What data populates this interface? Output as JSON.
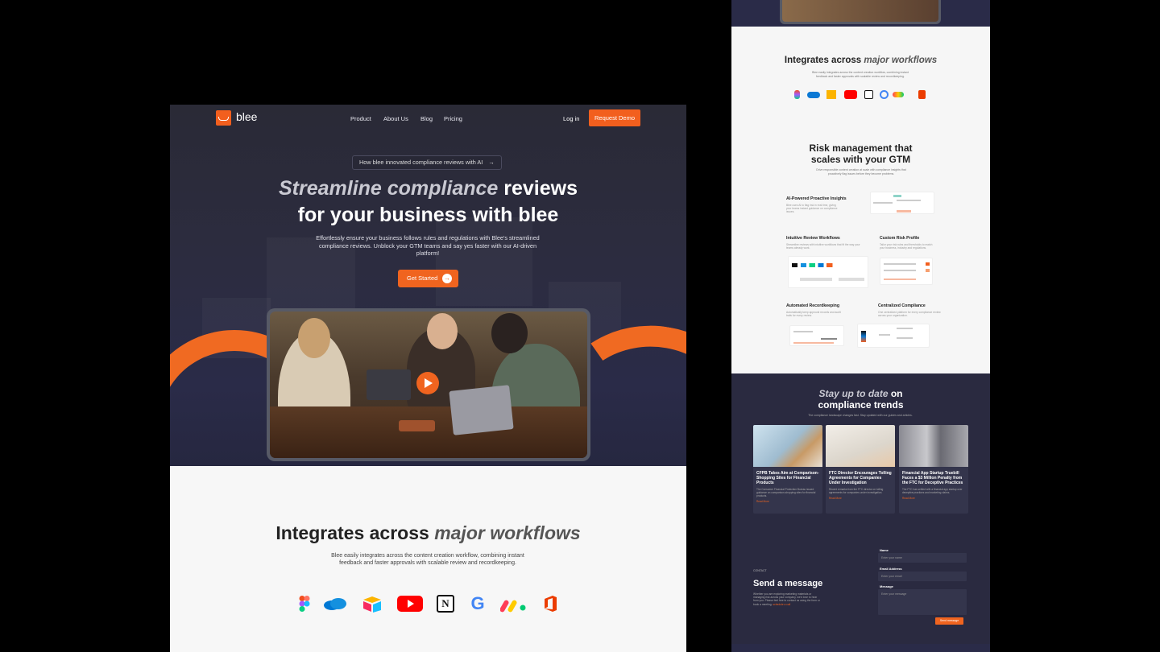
{
  "nav": {
    "logo": "blee",
    "links": [
      "Product",
      "About Us",
      "Blog",
      "Pricing"
    ],
    "login": "Log in",
    "cta": "Request Demo"
  },
  "hero": {
    "pill": "How blee innovated compliance reviews with AI",
    "pill_arrow": "→",
    "title_italic": "Streamline compliance",
    "title_rest": "reviews",
    "title_line2": "for your business with blee",
    "subtitle": "Effortlessly ensure your business follows rules and regulations with Blee's streamlined compliance reviews. Unblock your GTM teams and say yes faster with our AI-driven platform!",
    "cta": "Get Started",
    "cta_arrow": "→"
  },
  "integrations": {
    "title_plain": "Integrates across",
    "title_italic": "major workflows",
    "subtitle": "Blee easily integrates across the content creation workflow, combining instant feedback and faster approvals with scalable review and recordkeeping.",
    "icons": [
      "figma-icon",
      "onedrive-icon",
      "airtable-icon",
      "youtube-icon",
      "notion-icon",
      "google-icon",
      "monday-icon",
      "office-icon"
    ],
    "notion_letter": "N",
    "google_letter": "G"
  },
  "right": {
    "integ_title_plain": "Integrates across",
    "integ_title_italic": "major workflows",
    "integ_sub": "Blee easily integrates across the content creation workflow, combining instant feedback and faster approvals with scalable review and recordkeeping.",
    "risk_title_1": "Risk management that",
    "risk_title_2": "scales with your GTM",
    "risk_sub": "Drive responsible content creation at scale with compliance insights that proactively flag issues before they become problems.",
    "features": [
      {
        "title": "AI-Powered Proactive Insights",
        "text": "Blee uses AI to flag risk in real time, giving your teams instant guidance on compliance issues."
      },
      {
        "title": "Intuitive Review Workflows",
        "text": "Streamline reviews with intuitive workflows that fit the way your teams already work."
      },
      {
        "title": "Custom Risk Profile",
        "text": "Tailor your risk rules and thresholds to match your business, industry and regulations."
      },
      {
        "title": "Automated Recordkeeping",
        "text": "Automatically keep approval records and audit trails for every review."
      },
      {
        "title": "Centralized Compliance",
        "text": "One centralized platform for every compliance review across your organization."
      }
    ],
    "news_title_italic": "Stay up to date",
    "news_title_rest": "on",
    "news_title_line2": "compliance trends",
    "news_sub": "The compliance landscape changes fast. Stay updated with our guides and articles.",
    "cards": [
      {
        "title": "CFPB Takes Aim at Comparison-Shopping Sites for Financial Products",
        "text": "The Consumer Financial Protection Bureau issued guidance on comparison-shopping sites for financial products.",
        "link": "Read More"
      },
      {
        "title": "FTC Director Encourages Tolling Agreements for Companies Under Investigation",
        "text": "Recent remarks from the FTC director on tolling agreements for companies under investigation.",
        "link": "Read More"
      },
      {
        "title": "Financial App Startup Truebill Faces a $3 Million Penalty from the FTC for Deceptive Practices",
        "text": "The FTC has settled with a financial app startup over deceptive practices and marketing claims.",
        "link": "Read More"
      }
    ],
    "contact_kicker": "CONTACT",
    "contact_title": "Send a message",
    "contact_text": "Whether you are exploring marketing materials or managing risk across your company, we'd love to hear from you. Please feel free to contact us using the form or book a meeting.",
    "contact_link": "schedule a call",
    "form": {
      "name_label": "Name",
      "name_placeholder": "Enter your name",
      "email_label": "Email Address",
      "email_placeholder": "Enter your email",
      "message_label": "Message",
      "message_placeholder": "Enter your message",
      "submit": "Send message"
    }
  },
  "colors": {
    "accent": "#f25f1e",
    "dark": "#2a2b48",
    "light": "#f7f7f7"
  }
}
